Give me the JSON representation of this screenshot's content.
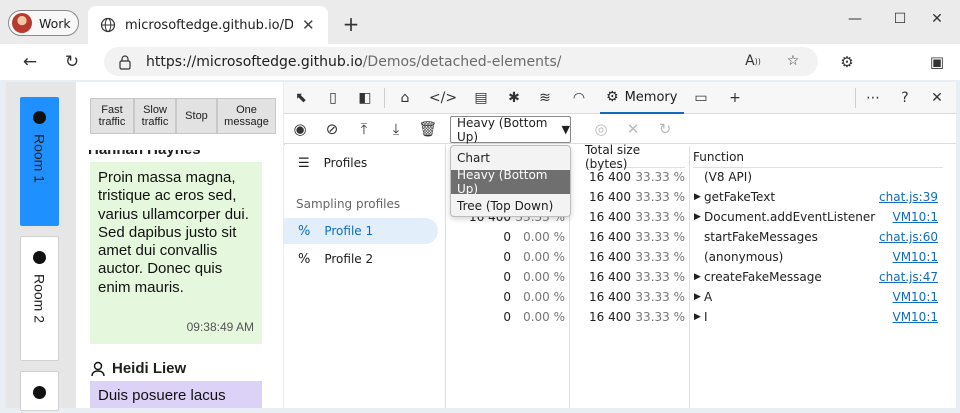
{
  "browser": {
    "profile_label": "Work",
    "tab_title": "microsoftedge.github.io/Demos/detached-elements/",
    "url_scheme": "https://",
    "url_host": "microsoftedge.github.io",
    "url_path": "/Demos/detached-elements/"
  },
  "page": {
    "rooms": [
      {
        "label": "Room 1"
      },
      {
        "label": "Room 2"
      }
    ],
    "buttons": {
      "fast": "Fast traffic",
      "slow": "Slow traffic",
      "stop": "Stop",
      "one": "One message"
    },
    "messages": [
      {
        "author": "Hannah Haynes",
        "text": "Proin massa magna, tristique ac eros sed, varius ullamcorper dui. Sed dapibus justo sit amet dui convallis auctor. Donec quis enim mauris.",
        "time": "09:38:49 AM"
      },
      {
        "author": "Heidi Liew",
        "text": "Duis posuere lacus"
      }
    ]
  },
  "devtools": {
    "memory_tab": "Memory",
    "view_select": "Heavy (Bottom Up)",
    "view_options": [
      "Chart",
      "Heavy (Bottom Up)",
      "Tree (Top Down)"
    ],
    "sidebar": {
      "profiles": "Profiles",
      "heading": "Sampling profiles",
      "items": [
        "Profile 1",
        "Profile 2"
      ]
    },
    "columns": {
      "total": "Total size (bytes)",
      "function": "Function"
    },
    "rows": [
      {
        "self": "",
        "self_pct": "",
        "total": "16 400",
        "total_pct": "33.33 %",
        "arrow": "",
        "fn": "(V8 API)",
        "link": ""
      },
      {
        "self": "",
        "self_pct": "",
        "total": "16 400",
        "total_pct": "33.33 %",
        "arrow": "▶",
        "fn": "getFakeText",
        "link": "chat.js:39"
      },
      {
        "self": "16 400",
        "self_pct": "33.33 %",
        "total": "16 400",
        "total_pct": "33.33 %",
        "arrow": "▶",
        "fn": "Document.addEventListener",
        "link": "VM10:1"
      },
      {
        "self": "0",
        "self_pct": "0.00 %",
        "total": "16 400",
        "total_pct": "33.33 %",
        "arrow": "",
        "fn": "startFakeMessages",
        "link": "chat.js:60"
      },
      {
        "self": "0",
        "self_pct": "0.00 %",
        "total": "16 400",
        "total_pct": "33.33 %",
        "arrow": "",
        "fn": "(anonymous)",
        "link": "VM10:1"
      },
      {
        "self": "0",
        "self_pct": "0.00 %",
        "total": "16 400",
        "total_pct": "33.33 %",
        "arrow": "▶",
        "fn": "createFakeMessage",
        "link": "chat.js:47"
      },
      {
        "self": "0",
        "self_pct": "0.00 %",
        "total": "16 400",
        "total_pct": "33.33 %",
        "arrow": "▶",
        "fn": "A",
        "link": "VM10:1"
      },
      {
        "self": "0",
        "self_pct": "0.00 %",
        "total": "16 400",
        "total_pct": "33.33 %",
        "arrow": "▶",
        "fn": "I",
        "link": "VM10:1"
      }
    ]
  }
}
